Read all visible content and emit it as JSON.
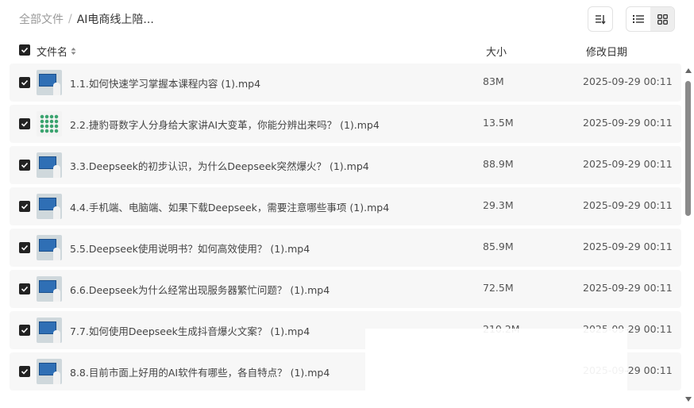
{
  "breadcrumb": {
    "root": "全部文件",
    "separator": "/",
    "current": "AI电商线上陪..."
  },
  "header": {
    "name": "文件名",
    "size": "大小",
    "date": "修改日期"
  },
  "files": [
    {
      "name": "1.1.如何快速学习掌握本课程内容 (1).mp4",
      "size": "83M",
      "date": "2025-09-29 00:11",
      "thumb": "video"
    },
    {
      "name": "2.2.捷豹哥数字人分身给大家讲AI大变革，你能分辨出来吗？ (1).mp4",
      "size": "13.5M",
      "date": "2025-09-29 00:11",
      "thumb": "grid"
    },
    {
      "name": "3.3.Deepseek的初步认识，为什么Deepseek突然爆火？ (1).mp4",
      "size": "88.9M",
      "date": "2025-09-29 00:11",
      "thumb": "video"
    },
    {
      "name": "4.4.手机端、电脑端、如果下载Deepseek，需要注意哪些事项 (1).mp4",
      "size": "29.3M",
      "date": "2025-09-29 00:11",
      "thumb": "video"
    },
    {
      "name": "5.5.Deepseek使用说明书？如何高效使用？ (1).mp4",
      "size": "85.9M",
      "date": "2025-09-29 00:11",
      "thumb": "video"
    },
    {
      "name": "6.6.Deepseek为什么经常出现服务器繁忙问题？ (1).mp4",
      "size": "72.5M",
      "date": "2025-09-29 00:11",
      "thumb": "video"
    },
    {
      "name": "7.7.如何使用Deepseek生成抖音爆火文案？ (1).mp4",
      "size": "210.2M",
      "date": "2025-09-29 00:11",
      "thumb": "video"
    },
    {
      "name": "8.8.目前市面上好用的AI软件有哪些，各自特点？ (1).mp4",
      "size": "",
      "date": "2025-09-29 00:11",
      "thumb": "video"
    }
  ],
  "colors": {
    "row_bg": "#f7f7f7",
    "checkbox": "#222222",
    "muted": "#9a9a9a"
  },
  "icons": {
    "sort": "sort-icon",
    "list_view": "list-view-icon",
    "grid_view": "grid-view-icon",
    "check": "check-icon",
    "sort_caret": "sort-caret-icon"
  }
}
